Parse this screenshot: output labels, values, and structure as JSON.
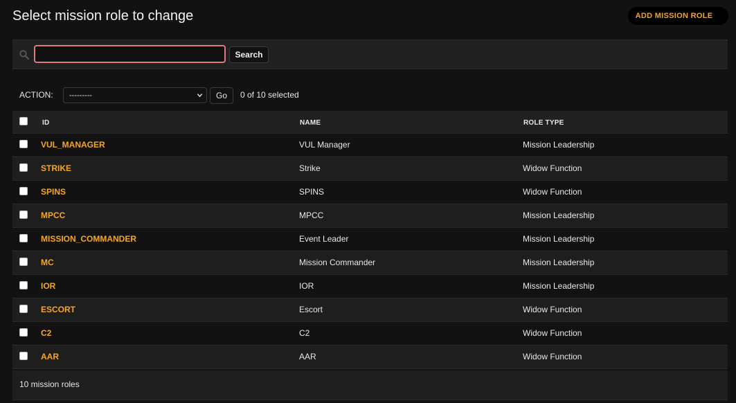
{
  "header": {
    "title": "Select mission role to change",
    "add_button_label": "ADD MISSION ROLE"
  },
  "search": {
    "value": "",
    "button_label": "Search",
    "icon": "search-icon"
  },
  "actions": {
    "label": "ACTION:",
    "selected_option": "---------",
    "go_label": "Go",
    "selected_count_text": "0 of 10 selected"
  },
  "table": {
    "columns": [
      "ID",
      "NAME",
      "ROLE TYPE"
    ],
    "rows": [
      {
        "id": "VUL_MANAGER",
        "name": "VUL Manager",
        "role_type": "Mission Leadership"
      },
      {
        "id": "STRIKE",
        "name": "Strike",
        "role_type": "Widow Function"
      },
      {
        "id": "SPINS",
        "name": "SPINS",
        "role_type": "Widow Function"
      },
      {
        "id": "MPCC",
        "name": "MPCC",
        "role_type": "Mission Leadership"
      },
      {
        "id": "MISSION_COMMANDER",
        "name": "Event Leader",
        "role_type": "Mission Leadership"
      },
      {
        "id": "MC",
        "name": "Mission Commander",
        "role_type": "Mission Leadership"
      },
      {
        "id": "IOR",
        "name": "IOR",
        "role_type": "Mission Leadership"
      },
      {
        "id": "ESCORT",
        "name": "Escort",
        "role_type": "Widow Function"
      },
      {
        "id": "C2",
        "name": "C2",
        "role_type": "Widow Function"
      },
      {
        "id": "AAR",
        "name": "AAR",
        "role_type": "Widow Function"
      }
    ]
  },
  "footer": {
    "count_text": "10 mission roles"
  },
  "colors": {
    "background": "#121212",
    "panel": "#212121",
    "accent": "#f5a623",
    "focus_border": "#e07b7b"
  }
}
